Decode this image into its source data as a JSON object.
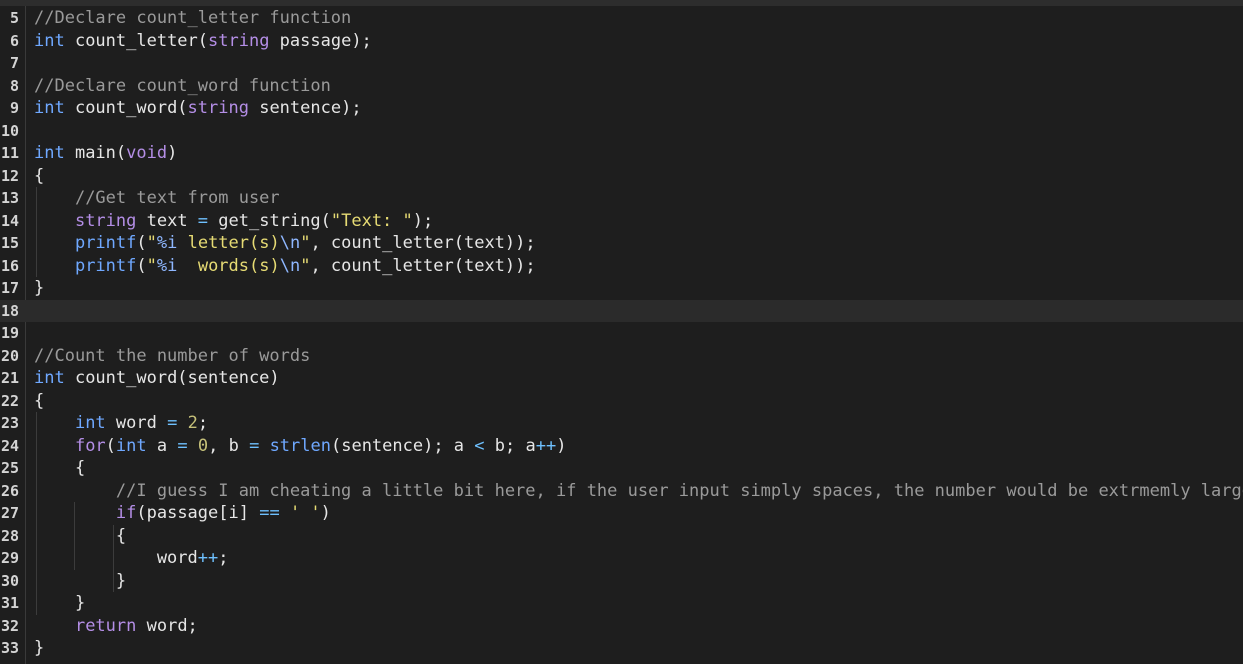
{
  "editor": {
    "lines": [
      {
        "num": "5",
        "tokens": [
          {
            "t": "//Declare count_letter function",
            "c": "comm"
          }
        ]
      },
      {
        "num": "6",
        "tokens": [
          {
            "t": "int",
            "c": "kwb"
          },
          {
            "t": " count_letter(",
            "c": "text"
          },
          {
            "t": "string",
            "c": "kw"
          },
          {
            "t": " passage);",
            "c": "text"
          }
        ]
      },
      {
        "num": "7",
        "tokens": []
      },
      {
        "num": "8",
        "tokens": [
          {
            "t": "//Declare count_word function",
            "c": "comm"
          }
        ]
      },
      {
        "num": "9",
        "tokens": [
          {
            "t": "int",
            "c": "kwb"
          },
          {
            "t": " count_word(",
            "c": "text"
          },
          {
            "t": "string",
            "c": "kw"
          },
          {
            "t": " sentence);",
            "c": "text"
          }
        ]
      },
      {
        "num": "10",
        "tokens": []
      },
      {
        "num": "11",
        "tokens": [
          {
            "t": "int",
            "c": "kwb"
          },
          {
            "t": " main(",
            "c": "text"
          },
          {
            "t": "void",
            "c": "kw"
          },
          {
            "t": ")",
            "c": "text"
          }
        ]
      },
      {
        "num": "12",
        "tokens": [
          {
            "t": "{",
            "c": "text"
          }
        ]
      },
      {
        "num": "13",
        "tokens": [
          {
            "t": "    ",
            "c": "text"
          },
          {
            "t": "//Get text from user",
            "c": "comm"
          }
        ]
      },
      {
        "num": "14",
        "tokens": [
          {
            "t": "    ",
            "c": "text"
          },
          {
            "t": "string",
            "c": "kw"
          },
          {
            "t": " text ",
            "c": "text"
          },
          {
            "t": "=",
            "c": "op"
          },
          {
            "t": " get_string(",
            "c": "text"
          },
          {
            "t": "\"Text: \"",
            "c": "str"
          },
          {
            "t": ");",
            "c": "text"
          }
        ]
      },
      {
        "num": "15",
        "tokens": [
          {
            "t": "    ",
            "c": "text"
          },
          {
            "t": "printf",
            "c": "kwb"
          },
          {
            "t": "(",
            "c": "text"
          },
          {
            "t": "\"",
            "c": "str"
          },
          {
            "t": "%i",
            "c": "esc"
          },
          {
            "t": " letter(s)",
            "c": "str"
          },
          {
            "t": "\\n",
            "c": "esc"
          },
          {
            "t": "\"",
            "c": "str"
          },
          {
            "t": ", count_letter(text));",
            "c": "text"
          }
        ]
      },
      {
        "num": "16",
        "tokens": [
          {
            "t": "    ",
            "c": "text"
          },
          {
            "t": "printf",
            "c": "kwb"
          },
          {
            "t": "(",
            "c": "text"
          },
          {
            "t": "\"",
            "c": "str"
          },
          {
            "t": "%i",
            "c": "esc"
          },
          {
            "t": "  words(s)",
            "c": "str"
          },
          {
            "t": "\\n",
            "c": "esc"
          },
          {
            "t": "\"",
            "c": "str"
          },
          {
            "t": ", count_letter(text));",
            "c": "text"
          }
        ]
      },
      {
        "num": "17",
        "tokens": [
          {
            "t": "}",
            "c": "text"
          }
        ]
      },
      {
        "num": "18",
        "tokens": [],
        "highlight": true
      },
      {
        "num": "19",
        "tokens": []
      },
      {
        "num": "20",
        "tokens": [
          {
            "t": "//Count the number of words",
            "c": "comm"
          }
        ]
      },
      {
        "num": "21",
        "tokens": [
          {
            "t": "int",
            "c": "kwb"
          },
          {
            "t": " count_word(sentence)",
            "c": "text"
          }
        ]
      },
      {
        "num": "22",
        "tokens": [
          {
            "t": "{",
            "c": "text"
          }
        ]
      },
      {
        "num": "23",
        "tokens": [
          {
            "t": "    ",
            "c": "text"
          },
          {
            "t": "int",
            "c": "kwb"
          },
          {
            "t": " word ",
            "c": "text"
          },
          {
            "t": "=",
            "c": "op"
          },
          {
            "t": " ",
            "c": "text"
          },
          {
            "t": "2",
            "c": "num"
          },
          {
            "t": ";",
            "c": "text"
          }
        ]
      },
      {
        "num": "24",
        "tokens": [
          {
            "t": "    ",
            "c": "text"
          },
          {
            "t": "for",
            "c": "kw"
          },
          {
            "t": "(",
            "c": "text"
          },
          {
            "t": "int",
            "c": "kwb"
          },
          {
            "t": " a ",
            "c": "text"
          },
          {
            "t": "=",
            "c": "op"
          },
          {
            "t": " ",
            "c": "text"
          },
          {
            "t": "0",
            "c": "num"
          },
          {
            "t": ", b ",
            "c": "text"
          },
          {
            "t": "=",
            "c": "op"
          },
          {
            "t": " ",
            "c": "text"
          },
          {
            "t": "strlen",
            "c": "kwb"
          },
          {
            "t": "(sentence); a ",
            "c": "text"
          },
          {
            "t": "<",
            "c": "op"
          },
          {
            "t": " b; a",
            "c": "text"
          },
          {
            "t": "++",
            "c": "op"
          },
          {
            "t": ")",
            "c": "text"
          }
        ]
      },
      {
        "num": "25",
        "tokens": [
          {
            "t": "    {",
            "c": "text"
          }
        ]
      },
      {
        "num": "26",
        "tokens": [
          {
            "t": "        ",
            "c": "text"
          },
          {
            "t": "//I guess I am cheating a little bit here, if the user input simply spaces, the number would be extrmemly large",
            "c": "comm"
          }
        ]
      },
      {
        "num": "27",
        "tokens": [
          {
            "t": "        ",
            "c": "text"
          },
          {
            "t": "if",
            "c": "kw"
          },
          {
            "t": "(passage[i] ",
            "c": "text"
          },
          {
            "t": "==",
            "c": "op"
          },
          {
            "t": " ",
            "c": "text"
          },
          {
            "t": "' '",
            "c": "str"
          },
          {
            "t": ")",
            "c": "text"
          }
        ]
      },
      {
        "num": "28",
        "tokens": [
          {
            "t": "        {",
            "c": "text"
          }
        ]
      },
      {
        "num": "29",
        "tokens": [
          {
            "t": "            word",
            "c": "text"
          },
          {
            "t": "++",
            "c": "op"
          },
          {
            "t": ";",
            "c": "text"
          }
        ]
      },
      {
        "num": "30",
        "tokens": [
          {
            "t": "        }",
            "c": "text"
          }
        ]
      },
      {
        "num": "31",
        "tokens": [
          {
            "t": "    }",
            "c": "text"
          }
        ]
      },
      {
        "num": "32",
        "tokens": [
          {
            "t": "    ",
            "c": "text"
          },
          {
            "t": "return",
            "c": "kw"
          },
          {
            "t": " word;",
            "c": "text"
          }
        ]
      },
      {
        "num": "33",
        "tokens": [
          {
            "t": "}",
            "c": "text"
          }
        ]
      }
    ]
  }
}
